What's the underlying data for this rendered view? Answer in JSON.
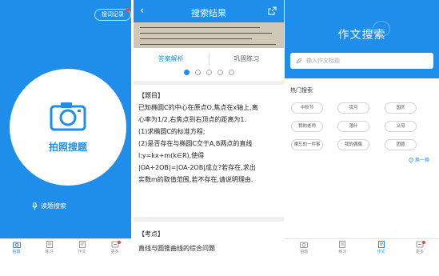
{
  "left": {
    "history_label": "搜词记录",
    "capture_label": "拍照搜题",
    "read_search_label": "读题搜索"
  },
  "tabs": [
    "拍题",
    "练习",
    "作文",
    "更多"
  ],
  "middle": {
    "title": "搜索结果",
    "seg_answer": "答案解析",
    "seg_practice": "巩固练习",
    "q_header": "【题目】",
    "q_lines": [
      "已知椭圆C的中心在原点O,焦点在x轴上,离",
      "心率为1/2,右焦点到右顶点的距离为1.",
      "(1)求椭圆C的标准方程;",
      "(2)是否存在与椭圆C交于A,B两点的直线",
      "l:y=kx+m(k∈R),使得",
      "|OA+2OB|=|OA-2OB|成立?若存在,求出",
      "实数m的取值范围,若不存在,请说明理由."
    ],
    "kd_header": "【考点】",
    "kd_text": "直线与圆锥曲线的综合问题"
  },
  "right": {
    "title": "作文搜索",
    "search_placeholder": "输入作文标题",
    "hot_label": "热门搜索",
    "chips": [
      "中秋节",
      "赏月",
      "国庆",
      "我的老师",
      "落叶",
      "父母",
      "难忘的一件事",
      "我的偶像",
      "团圆"
    ],
    "swap_label": "换一换"
  },
  "colors": {
    "accent": "#1f8dea",
    "badge": "#e84b3c"
  }
}
